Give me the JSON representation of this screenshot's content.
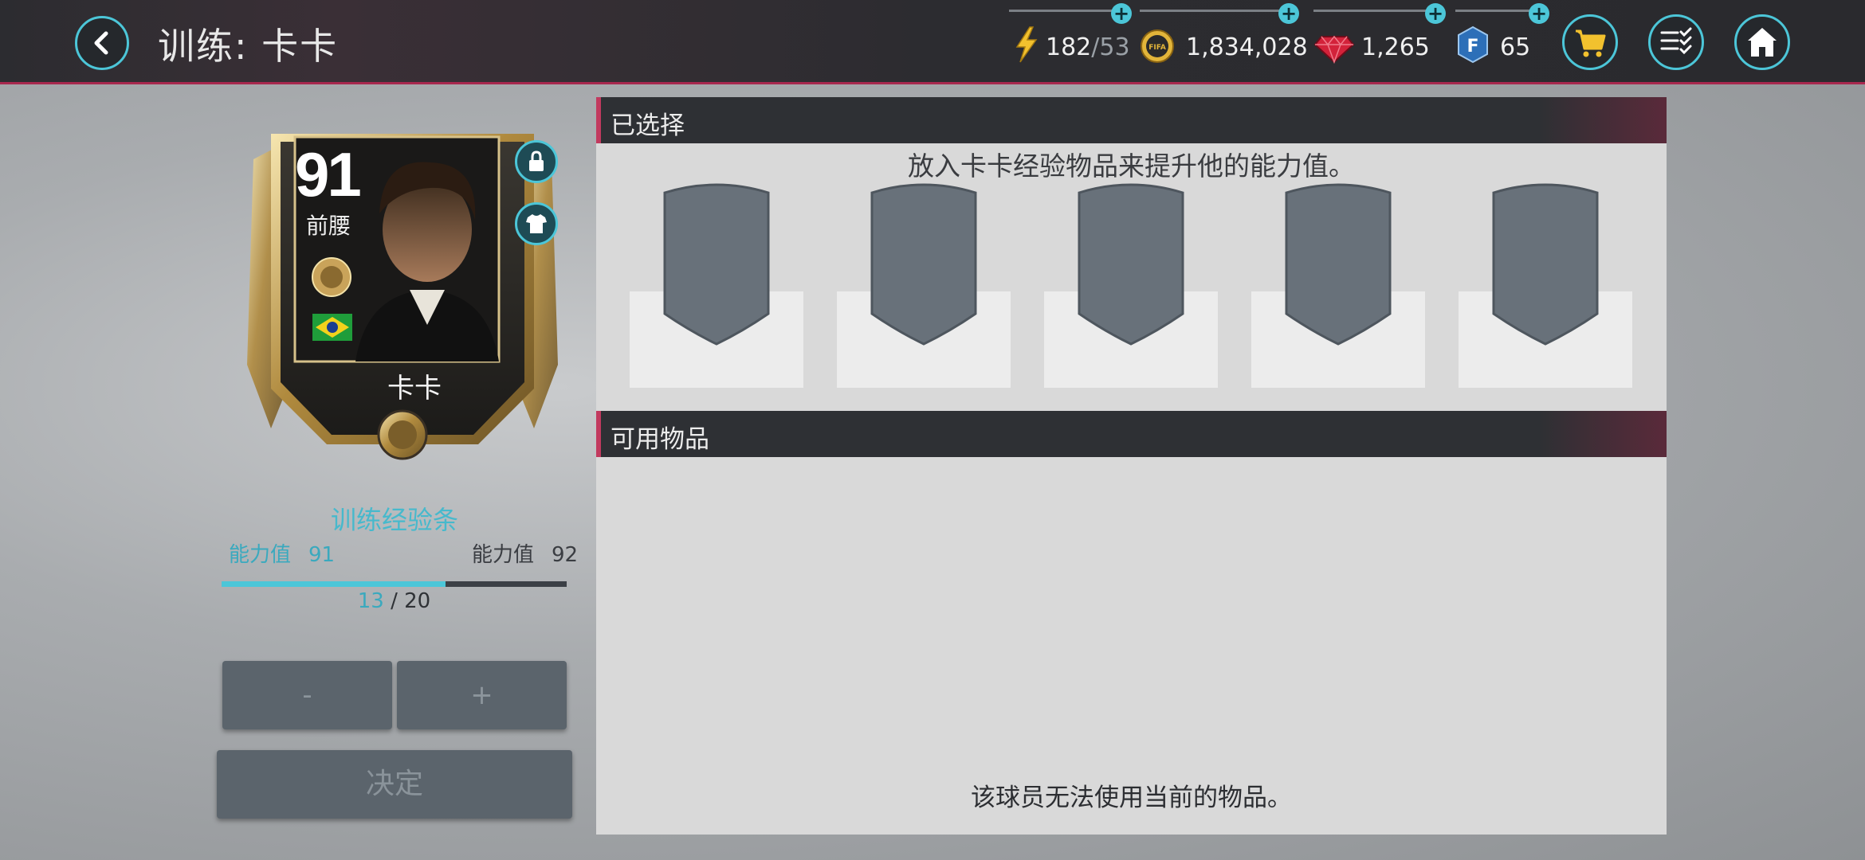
{
  "header": {
    "title": "训练: 卡卡",
    "energy": {
      "current": "182",
      "separator": "/",
      "max": "53"
    },
    "coins": "1,834,028",
    "gems": "1,265",
    "fifa_points": "65",
    "icons": [
      "back-arrow-icon",
      "lightning-icon",
      "coin-icon",
      "gem-icon",
      "fifa-points-icon",
      "cart-icon",
      "checklist-icon",
      "home-icon"
    ],
    "colors": {
      "accent": "#4cc6d8",
      "header_border": "#a8284e",
      "coin": "#e2b53a",
      "gem": "#d3223a",
      "points": "#2d6fb8"
    }
  },
  "player_card": {
    "rating": "91",
    "position": "前腰",
    "name": "卡卡",
    "nation": "brazil-flag-icon",
    "side_icons": [
      "lock-icon",
      "kit-shirt-icon"
    ]
  },
  "training": {
    "title": "训练经验条",
    "current_label": "能力值",
    "current_value": "91",
    "next_label": "能力值",
    "next_value": "92",
    "progress": {
      "current": "13",
      "separator": "/",
      "total": "20",
      "fraction": 0.65
    },
    "minus_label": "-",
    "plus_label": "+",
    "confirm_label": "决定"
  },
  "selected_panel": {
    "title": "已选择",
    "hint": "放入卡卡经验物品来提升他的能力值。",
    "slot_count": 5
  },
  "items_panel": {
    "title": "可用物品",
    "empty_message": "该球员无法使用当前的物品。"
  }
}
